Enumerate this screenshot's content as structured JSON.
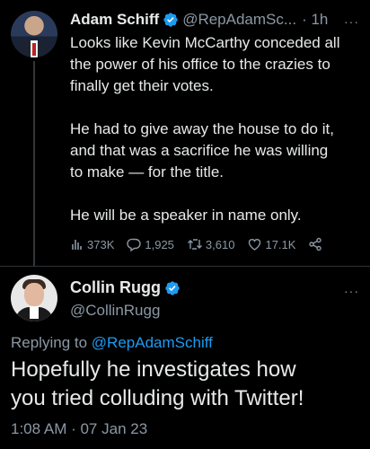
{
  "original_tweet": {
    "author_name": "Adam Schiff",
    "handle": "@RepAdamSc...",
    "time": "· 1h",
    "more": "···",
    "body_paragraphs": [
      [
        "Looks like Kevin McCarthy conceded all",
        "the power of his office to the crazies to",
        "finally get their votes."
      ],
      [
        "He had to give away the house to do it,",
        "and that was a sacrifice he was willing",
        "to make — for the title."
      ],
      [
        "He will be a speaker in name only."
      ]
    ],
    "stats": {
      "views": "373K",
      "replies": "1,925",
      "retweets": "3,610",
      "likes": "17.1K"
    }
  },
  "reply_tweet": {
    "author_name": "Collin Rugg",
    "handle": "@CollinRugg",
    "more": "···",
    "replying_prefix": "Replying to",
    "replying_mention": "@RepAdamSchiff",
    "body_lines": [
      "Hopefully he investigates how",
      "you tried colluding with Twitter!"
    ],
    "timestamp": "1:08 AM · 07 Jan 23"
  },
  "colors": {
    "background": "#000000",
    "text": "#e7e9ea",
    "muted": "#8b98a5",
    "accent": "#1d9bf0"
  },
  "icons": [
    "verified-badge-icon",
    "views-icon",
    "reply-icon",
    "retweet-icon",
    "like-icon",
    "share-icon",
    "more-icon"
  ]
}
